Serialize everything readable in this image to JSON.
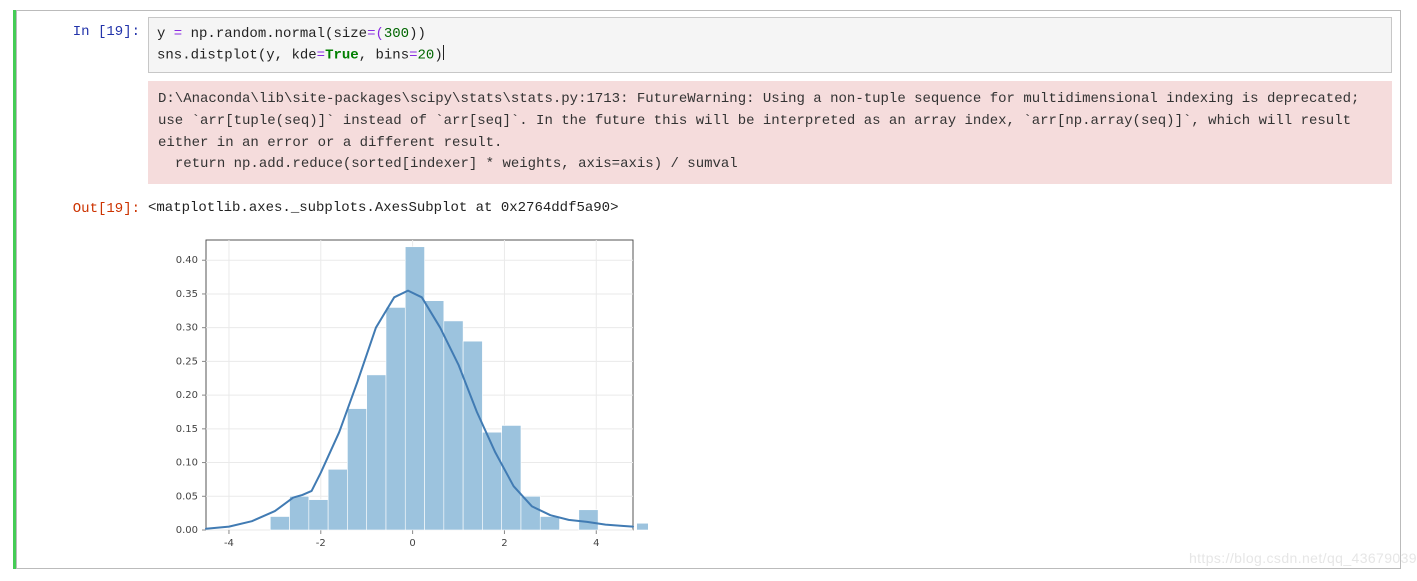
{
  "cell": {
    "in_prompt_label": "In  [",
    "in_prompt_num": "19",
    "in_prompt_close": "]:",
    "out_prompt_label": "Out[",
    "out_prompt_num": "19",
    "out_prompt_close": "]:",
    "code": {
      "l1_y": "y",
      "l1_eq": " = ",
      "l1_np": "np.random.normal",
      "l1_open": "(",
      "l1_size": "size",
      "l1_seq": "=(",
      "l1_300": "300",
      "l1_close": "))",
      "l2_sns": "sns.distplot",
      "l2_open": "(",
      "l2_y": "y",
      "l2_c1": ", ",
      "l2_kde": "kde",
      "l2_eq": "=",
      "l2_true": "True",
      "l2_c2": ", ",
      "l2_bins": "bins",
      "l2_eq2": "=",
      "l2_20": "20",
      "l2_close": ")"
    },
    "warning_text": "D:\\Anaconda\\lib\\site-packages\\scipy\\stats\\stats.py:1713: FutureWarning: Using a non-tuple sequence for multidimensional indexing is deprecated; use `arr[tuple(seq)]` instead of `arr[seq]`. In the future this will be interpreted as an array index, `arr[np.array(seq)]`, which will result either in an error or a different result.\n  return np.add.reduce(sorted[indexer] * weights, axis=axis) / sumval",
    "output_text": "<matplotlib.axes._subplots.AxesSubplot at 0x2764ddf5a90>"
  },
  "watermark": "https://blog.csdn.net/qq_43679039",
  "chart_data": {
    "type": "histogram_kde",
    "title": "",
    "xlabel": "",
    "ylabel": "",
    "xlim": [
      -4.5,
      4.8
    ],
    "ylim": [
      0.0,
      0.43
    ],
    "x_ticks": [
      -4,
      -2,
      0,
      2,
      4
    ],
    "y_ticks": [
      0.0,
      0.05,
      0.1,
      0.15,
      0.2,
      0.25,
      0.3,
      0.35,
      0.4
    ],
    "bins": 20,
    "bin_edges": [
      -3.1,
      -2.68,
      -2.26,
      -1.84,
      -1.42,
      -1.0,
      -0.58,
      -0.16,
      0.26,
      0.68,
      1.1,
      1.52,
      1.94,
      2.36,
      2.78,
      3.2,
      3.62,
      4.04,
      4.46,
      4.88,
      5.3
    ],
    "bar_categories_centers": [
      -2.89,
      -2.47,
      -2.05,
      -1.63,
      -1.21,
      -0.79,
      -0.37,
      0.05,
      0.47,
      0.89,
      1.31,
      1.73,
      2.15,
      2.57,
      2.99,
      3.41,
      3.83,
      4.25,
      4.67,
      5.09
    ],
    "bar_values": [
      0.02,
      0.05,
      0.045,
      0.09,
      0.18,
      0.23,
      0.33,
      0.42,
      0.34,
      0.31,
      0.28,
      0.145,
      0.155,
      0.05,
      0.02,
      0.0,
      0.03,
      0.0,
      0.0,
      0.01
    ],
    "kde_points": [
      [
        -4.5,
        0.002
      ],
      [
        -4.0,
        0.005
      ],
      [
        -3.5,
        0.013
      ],
      [
        -3.0,
        0.028
      ],
      [
        -2.6,
        0.048
      ],
      [
        -2.4,
        0.052
      ],
      [
        -2.2,
        0.058
      ],
      [
        -2.0,
        0.085
      ],
      [
        -1.6,
        0.145
      ],
      [
        -1.2,
        0.22
      ],
      [
        -0.8,
        0.3
      ],
      [
        -0.4,
        0.345
      ],
      [
        -0.1,
        0.355
      ],
      [
        0.2,
        0.345
      ],
      [
        0.6,
        0.3
      ],
      [
        1.0,
        0.245
      ],
      [
        1.4,
        0.175
      ],
      [
        1.8,
        0.115
      ],
      [
        2.2,
        0.065
      ],
      [
        2.6,
        0.035
      ],
      [
        3.0,
        0.022
      ],
      [
        3.4,
        0.015
      ],
      [
        3.8,
        0.012
      ],
      [
        4.2,
        0.008
      ],
      [
        4.6,
        0.006
      ],
      [
        4.8,
        0.005
      ]
    ]
  }
}
